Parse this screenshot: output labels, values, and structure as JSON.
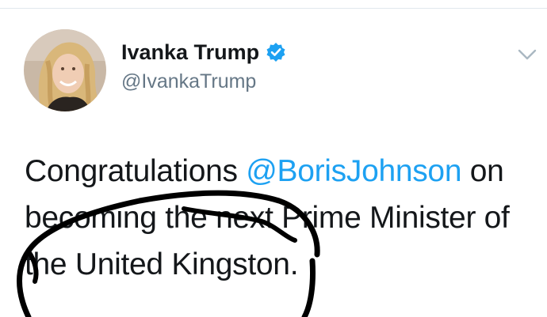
{
  "tweet": {
    "author": {
      "name": "Ivanka Trump",
      "handle": "@IvankaTrump",
      "verified": true
    },
    "text_lines": [
      {
        "before": "Congratulations ",
        "mention": "@BorisJohnson",
        "after": " on"
      },
      {
        "text": "becoming the next Prime Minister of"
      },
      {
        "text": "the United Kingston."
      }
    ]
  },
  "colors": {
    "link": "#1da1f2",
    "verified": "#1da1f2",
    "text": "#14171a",
    "secondary": "#657786",
    "annotation": "#000000"
  },
  "icons": {
    "verified": "verified-badge-icon",
    "menu": "chevron-down-icon"
  }
}
